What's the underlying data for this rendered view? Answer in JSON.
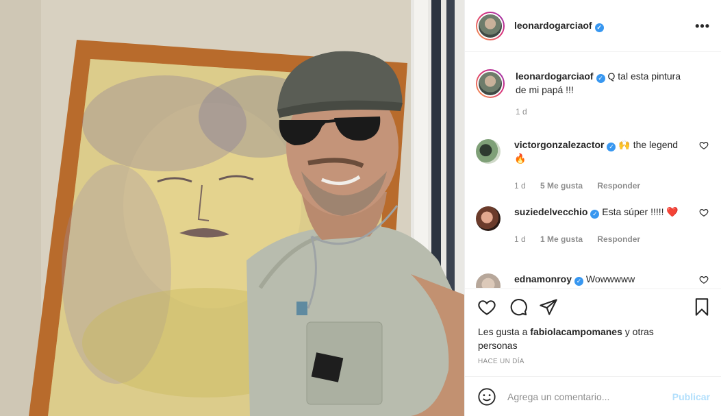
{
  "post": {
    "username": "leonardogarciaof",
    "verified_mark": "✓",
    "more_icon": "•••"
  },
  "caption": {
    "username": "leonardogarciaof",
    "text": "Q tal esta pintura de mi papá !!!",
    "time": "1 d"
  },
  "comments": [
    {
      "username": "victorgonzalezactor",
      "text": "🙌 the legend🔥",
      "time": "1 d",
      "likes": "5 Me gusta",
      "reply": "Responder"
    },
    {
      "username": "suziedelvecchio",
      "text": "Esta súper !!!!! ❤️",
      "time": "1 d",
      "likes": "1 Me gusta",
      "reply": "Responder"
    },
    {
      "username": "ednamonroy",
      "text": "Wowwwww",
      "time": "",
      "likes": "",
      "reply": ""
    }
  ],
  "likes": {
    "prefix": "Les gusta a",
    "user": "fabiolacampomanes",
    "suffix": "y otras personas"
  },
  "timestamp": "HACE UN DÍA",
  "add_comment": {
    "placeholder": "Agrega un comentario...",
    "publish_label": "Publicar"
  },
  "colors": {
    "verified": "#3897f0",
    "publish_disabled": "#b2dffc",
    "heart_red": "#ed4956"
  }
}
